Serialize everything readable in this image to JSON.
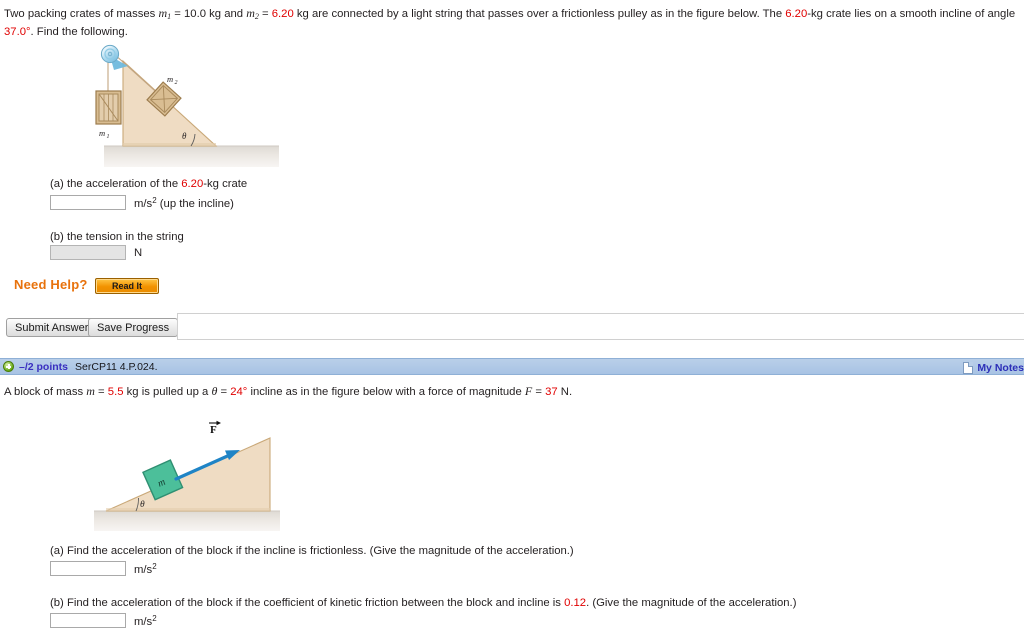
{
  "problem1": {
    "prompt_parts": {
      "p1": "Two packing crates of masses ",
      "m1_sym": "m",
      "m1_sub": "1",
      "eq1": " = ",
      "m1_val": "10.0 kg",
      "and": " and ",
      "m2_sym": "m",
      "m2_sub": "2",
      "eq2": " = ",
      "m2_val": "6.20",
      "kg": " kg",
      "p2": " are connected by a light string that passes over a frictionless pulley as in the figure below. The ",
      "m2_val2": "6.20",
      "p3": "-kg crate lies on a smooth incline of angle ",
      "angle_val": "37.0°",
      "p4": ". Find the following."
    },
    "figure": {
      "label_m1": "m",
      "label_m1_sub": "1",
      "label_m2": "m",
      "label_m2_sub": "2",
      "label_theta": "θ"
    },
    "part_a": {
      "label_pre": "(a) the acceleration of the ",
      "label_val": "6.20",
      "label_post": "-kg crate",
      "value": "",
      "unit_pre": "m/s",
      "unit_sup": "2",
      "unit_post": " (up the incline)"
    },
    "part_b": {
      "label": "(b) the tension in the string",
      "value": "",
      "unit": "N",
      "disabled": true
    },
    "need_help_label": "Need Help?",
    "read_it_label": "Read It",
    "submit_label": "Submit Answer",
    "save_label": "Save Progress"
  },
  "problem2": {
    "bar": {
      "points": "–/2 points",
      "code": "SerCP11 4.P.024.",
      "notes_label": "My Notes"
    },
    "prompt_parts": {
      "p1": "A block of mass ",
      "m_sym": "m",
      "eq1": " = ",
      "m_val": "5.5",
      "p2": " kg  is pulled up a ",
      "theta_sym": "θ",
      "eq2": " = ",
      "theta_val": "24°",
      "p3": "  incline as in the figure below with a force of magnitude ",
      "f_sym": "F",
      "eq3": " = ",
      "f_val": "37",
      "p4": " N."
    },
    "figure": {
      "label_F": "F",
      "label_m": "m",
      "label_theta": "θ"
    },
    "part_a": {
      "label": "(a) Find the acceleration of the block if the incline is frictionless. (Give the magnitude of the acceleration.)",
      "value": "",
      "unit_pre": "m/s",
      "unit_sup": "2"
    },
    "part_b": {
      "label_pre": "(b) Find the acceleration of the block if the coefficient of kinetic friction between the block and incline is ",
      "label_val": "0.12",
      "label_post": ". (Give the magnitude of the acceleration.)",
      "value": "",
      "unit_pre": "m/s",
      "unit_sup": "2"
    }
  },
  "colors": {
    "accent_red": "#e00000",
    "help_orange": "#e8720c",
    "bar_blue": "#a8c3e4",
    "link_blue": "#3a2fc0",
    "incline_fill": "#efdcc3",
    "incline_stroke": "#c8a57a",
    "ground_fill": "#e9e4df",
    "block_green": "#4cbf9a",
    "arrow_blue": "#1f84c6",
    "crate_wood": "#d6b98c"
  }
}
